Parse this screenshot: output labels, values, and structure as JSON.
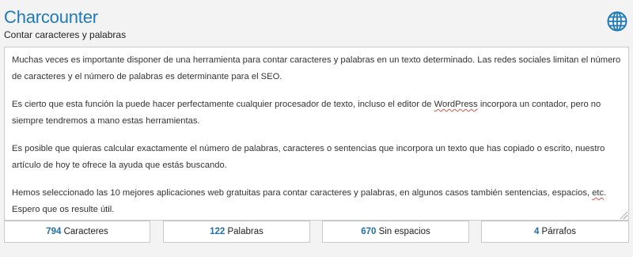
{
  "header": {
    "title": "Charcounter",
    "subtitle": "Contar caracteres y palabras",
    "language_icon": "globe-icon"
  },
  "editor": {
    "paragraphs": [
      {
        "before": "Muchas veces es importante disponer de una herramienta para contar caracteres y palabras en un texto determinado. Las redes sociales limitan el número de caracteres y el número de palabras es determinante para el SEO.",
        "spell": "",
        "after": ""
      },
      {
        "before": "Es cierto que esta función la puede hacer perfectamente cualquier procesador de texto, incluso el editor de ",
        "spell": "WordPress",
        "after": " incorpora un contador, pero no siempre tendremos a mano estas herramientas."
      },
      {
        "before": "Es posible que quieras calcular exactamente el número de palabras, caracteres o sentencias que incorpora un texto que has copiado o escrito, nuestro artículo de hoy te ofrece la ayuda que estás buscando.",
        "spell": "",
        "after": ""
      },
      {
        "before": "Hemos seleccionado las 10 mejores aplicaciones web gratuitas para contar caracteres y palabras, en algunos casos también sentencias, espacios, ",
        "spell": "etc",
        "after": ". Espero que os resulte útil."
      }
    ]
  },
  "stats": [
    {
      "value": "794",
      "label": " Caracteres"
    },
    {
      "value": "122",
      "label": " Palabras"
    },
    {
      "value": "670",
      "label": " Sin espacios"
    },
    {
      "value": "4",
      "label": " Párrafos"
    }
  ],
  "colors": {
    "accent": "#1f7ab8",
    "number": "#1f6fa8",
    "background": "#f3f3f3",
    "border": "#c9c9c9",
    "spellcheck": "#d9534f"
  }
}
